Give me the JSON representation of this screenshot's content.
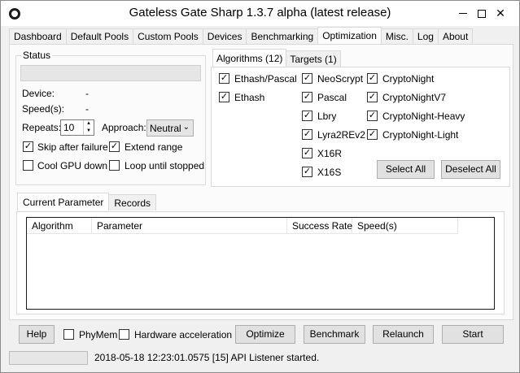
{
  "window": {
    "title": "Gateless Gate Sharp 1.3.7 alpha (latest release)",
    "minimize_glyph": "minimize-icon",
    "maximize_glyph": "maximize-icon",
    "close_glyph": "close-icon"
  },
  "tabs": [
    "Dashboard",
    "Default Pools",
    "Custom Pools",
    "Devices",
    "Benchmarking",
    "Optimization",
    "Misc.",
    "Log",
    "About"
  ],
  "active_tab": "Optimization",
  "status": {
    "group_label": "Status",
    "device_label": "Device:",
    "device_value": "-",
    "speed_label": "Speed(s):",
    "speed_value": "-",
    "repeats_label": "Repeats:",
    "repeats_value": "10",
    "approach_label": "Approach:",
    "approach_value": "Neutral",
    "skip_label": "Skip after failure",
    "extend_label": "Extend range",
    "cool_label": "Cool GPU down",
    "loop_label": "Loop until stopped"
  },
  "algorithms": {
    "tab_algorithms": "Algorithms (12)",
    "tab_targets": "Targets (1)",
    "items": [
      "Ethash/Pascal",
      "Ethash",
      "NeoScrypt",
      "Pascal",
      "Lbry",
      "Lyra2REv2",
      "X16R",
      "X16S",
      "CryptoNight",
      "CryptoNightV7",
      "CryptoNight-Heavy",
      "CryptoNight-Light"
    ],
    "select_all": "Select All",
    "deselect_all": "Deselect All"
  },
  "parameter": {
    "tab_current": "Current Parameter",
    "tab_records": "Records",
    "columns": [
      "Algorithm",
      "Parameter",
      "Success Rate",
      "Speed(s)"
    ]
  },
  "bottom": {
    "help": "Help",
    "phymem": "PhyMem",
    "hwaccel": "Hardware acceleration",
    "optimize": "Optimize",
    "benchmark": "Benchmark",
    "relaunch": "Relaunch",
    "start": "Start"
  },
  "statusbar": {
    "message": "2018-05-18 12:23:01.0575 [15] API Listener started."
  }
}
